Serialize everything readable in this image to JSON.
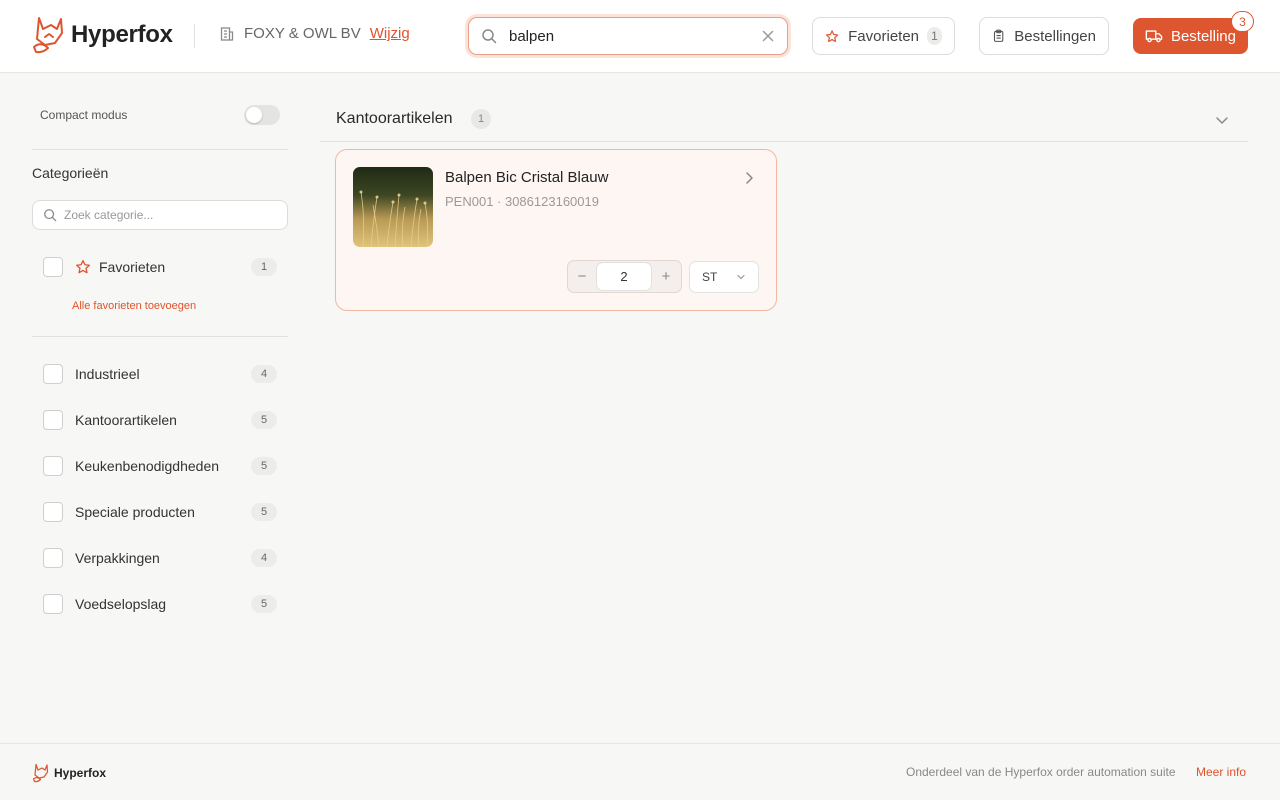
{
  "brand": {
    "name": "Hyperfox",
    "accent": "#de5630"
  },
  "header": {
    "company_name": "FOXY & OWL BV",
    "change_label": "Wijzig",
    "search_value": "balpen",
    "favorites_label": "Favorieten",
    "favorites_count": "1",
    "orders_label": "Bestellingen",
    "order_label": "Bestelling",
    "order_badge": "3"
  },
  "sidebar": {
    "compact_label": "Compact modus",
    "compact_on": false,
    "categories_title": "Categorieën",
    "category_search_placeholder": "Zoek categorie...",
    "favorites": {
      "label": "Favorieten",
      "count": "1"
    },
    "add_favorites_label": "Alle favorieten toevoegen",
    "items": [
      {
        "label": "Industrieel",
        "count": "4"
      },
      {
        "label": "Kantoorartikelen",
        "count": "5"
      },
      {
        "label": "Keukenbenodigdheden",
        "count": "5"
      },
      {
        "label": "Speciale producten",
        "count": "5"
      },
      {
        "label": "Verpakkingen",
        "count": "4"
      },
      {
        "label": "Voedselopslag",
        "count": "5"
      }
    ]
  },
  "main": {
    "section_title": "Kantoorartikelen",
    "section_count": "1",
    "product": {
      "name": "Balpen Bic Cristal Blauw",
      "meta": "PEN001 · 3086123160019",
      "quantity": "2",
      "unit": "ST",
      "minus": "−",
      "plus": "+"
    }
  },
  "footer": {
    "brand": "Hyperfox",
    "text": "Onderdeel van de Hyperfox order automation suite",
    "link": "Meer info"
  }
}
